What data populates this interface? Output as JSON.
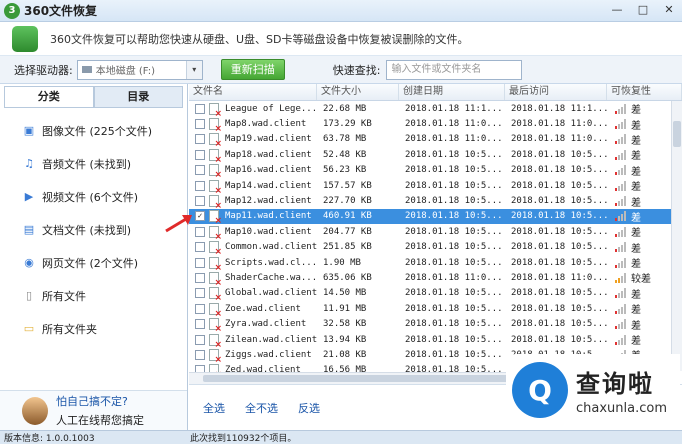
{
  "window": {
    "title": "360文件恢复",
    "logo_text": "3",
    "min": "—",
    "max": "□",
    "close": "✕"
  },
  "banner": {
    "description": "360文件恢复可以帮助您快速从硬盘、U盘、SD卡等磁盘设备中恢复被误删除的文件。"
  },
  "toolbar": {
    "drive_label": "选择驱动器:",
    "drive_value": "本地磁盘  (F:)",
    "drive_dropdown": "▾",
    "rescan_label": "重新扫描",
    "quick_search_label": "快速查找:",
    "search_placeholder": "输入文件或文件夹名"
  },
  "sidebar": {
    "tabs": [
      {
        "label": "分类"
      },
      {
        "label": "目录"
      }
    ],
    "items": [
      {
        "label": "图像文件 (225个文件)",
        "icon": "image-icon",
        "glyph": "▣"
      },
      {
        "label": "音频文件 (未找到)",
        "icon": "music-icon",
        "glyph": "♫"
      },
      {
        "label": "视频文件 (6个文件)",
        "icon": "video-icon",
        "glyph": "▶"
      },
      {
        "label": "文档文件 (未找到)",
        "icon": "document-icon",
        "glyph": "▤"
      },
      {
        "label": "网页文件 (2个文件)",
        "icon": "webpage-icon",
        "glyph": "◉"
      },
      {
        "label": "所有文件",
        "icon": "file-icon",
        "glyph": "▯"
      },
      {
        "label": "所有文件夹",
        "icon": "folder-icon",
        "glyph": "▭"
      }
    ],
    "help_title": "怕自己搞不定?",
    "help_subtitle": "人工在线帮您搞定"
  },
  "table": {
    "headers": [
      "文件名",
      "文件大小",
      "创建日期",
      "最后访问",
      "可恢复性"
    ],
    "rows": [
      {
        "name": "League of Lege...",
        "size": "22.68 MB",
        "created": "2018.01.18 11:1...",
        "accessed": "2018.01.18 11:1...",
        "rec": "差",
        "level": "low",
        "checked": false
      },
      {
        "name": "Map8.wad.client",
        "size": "173.29 KB",
        "created": "2018.01.18 11:0...",
        "accessed": "2018.01.18 11:0...",
        "rec": "差",
        "level": "low",
        "checked": false
      },
      {
        "name": "Map19.wad.client",
        "size": "63.78 MB",
        "created": "2018.01.18 11:0...",
        "accessed": "2018.01.18 11:0...",
        "rec": "差",
        "level": "low",
        "checked": false
      },
      {
        "name": "Map18.wad.client",
        "size": "52.48 KB",
        "created": "2018.01.18 10:5...",
        "accessed": "2018.01.18 10:5...",
        "rec": "差",
        "level": "low",
        "checked": false
      },
      {
        "name": "Map16.wad.client",
        "size": "56.23 KB",
        "created": "2018.01.18 10:5...",
        "accessed": "2018.01.18 10:5...",
        "rec": "差",
        "level": "low",
        "checked": false
      },
      {
        "name": "Map14.wad.client",
        "size": "157.57 KB",
        "created": "2018.01.18 10:5...",
        "accessed": "2018.01.18 10:5...",
        "rec": "差",
        "level": "low",
        "checked": false
      },
      {
        "name": "Map12.wad.client",
        "size": "227.70 KB",
        "created": "2018.01.18 10:5...",
        "accessed": "2018.01.18 10:5...",
        "rec": "差",
        "level": "low",
        "checked": false
      },
      {
        "name": "Map11.wad.client",
        "size": "460.91 KB",
        "created": "2018.01.18 10:5...",
        "accessed": "2018.01.18 10:5...",
        "rec": "差",
        "level": "low",
        "checked": true,
        "selected": true
      },
      {
        "name": "Map10.wad.client",
        "size": "204.77 KB",
        "created": "2018.01.18 10:5...",
        "accessed": "2018.01.18 10:5...",
        "rec": "差",
        "level": "low",
        "checked": false
      },
      {
        "name": "Common.wad.client",
        "size": "251.85 KB",
        "created": "2018.01.18 10:5...",
        "accessed": "2018.01.18 10:5...",
        "rec": "差",
        "level": "low",
        "checked": false
      },
      {
        "name": "Scripts.wad.cl...",
        "size": "1.90 MB",
        "created": "2018.01.18 10:5...",
        "accessed": "2018.01.18 10:5...",
        "rec": "差",
        "level": "low",
        "checked": false
      },
      {
        "name": "ShaderCache.wa...",
        "size": "635.06 KB",
        "created": "2018.01.18 11:0...",
        "accessed": "2018.01.18 11:0...",
        "rec": "较差",
        "level": "mid",
        "checked": false
      },
      {
        "name": "Global.wad.client",
        "size": "14.50 MB",
        "created": "2018.01.18 10:5...",
        "accessed": "2018.01.18 10:5...",
        "rec": "差",
        "level": "low",
        "checked": false
      },
      {
        "name": "Zoe.wad.client",
        "size": "11.91 MB",
        "created": "2018.01.18 10:5...",
        "accessed": "2018.01.18 10:5...",
        "rec": "差",
        "level": "low",
        "checked": false
      },
      {
        "name": "Zyra.wad.client",
        "size": "32.58 KB",
        "created": "2018.01.18 10:5...",
        "accessed": "2018.01.18 10:5...",
        "rec": "差",
        "level": "low",
        "checked": false
      },
      {
        "name": "Zilean.wad.client",
        "size": "13.94 KB",
        "created": "2018.01.18 10:5...",
        "accessed": "2018.01.18 10:5...",
        "rec": "差",
        "level": "low",
        "checked": false
      },
      {
        "name": "Ziggs.wad.client",
        "size": "21.08 KB",
        "created": "2018.01.18 10:5...",
        "accessed": "2018.01.18 10:5...",
        "rec": "差",
        "level": "low",
        "checked": false
      },
      {
        "name": "Zed.wad.client",
        "size": "16.56 MB",
        "created": "2018.01.18 10:5...",
        "accessed": "2018.01.18 10:5...",
        "rec": "差",
        "level": "low",
        "checked": false
      }
    ]
  },
  "actions": {
    "select_all": "全选",
    "select_none": "全不选",
    "invert": "反选"
  },
  "status": {
    "version": "版本信息: 1.0.0.1003",
    "found": "此次找到110932个项目。"
  },
  "watermark": {
    "glyph": "Q",
    "title": "查询啦",
    "url": "chaxunla.com"
  }
}
